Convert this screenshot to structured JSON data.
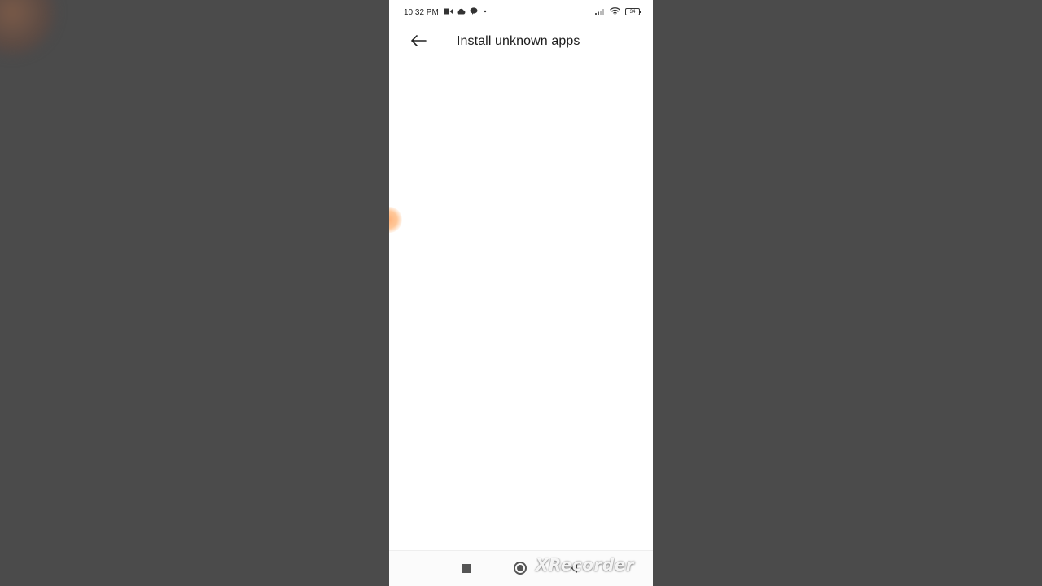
{
  "status_bar": {
    "time": "10:32 PM",
    "left_icons": [
      "video-camera-icon",
      "cloud-icon",
      "chat-bubble-icon",
      "dot-icon"
    ],
    "right_icons": [
      "signal-icon",
      "wifi-icon",
      "battery-icon"
    ],
    "battery_level": "34"
  },
  "app_bar": {
    "back_icon": "back-arrow-icon",
    "title": "Install unknown apps"
  },
  "nav_bar": {
    "buttons": [
      "recents-button",
      "home-button",
      "back-button"
    ]
  },
  "watermark": {
    "text": "XRecorder"
  },
  "colors": {
    "outside_background": "#4b4b4b",
    "screen_background": "#ffffff",
    "touch_indicator": "#ffb27a"
  }
}
